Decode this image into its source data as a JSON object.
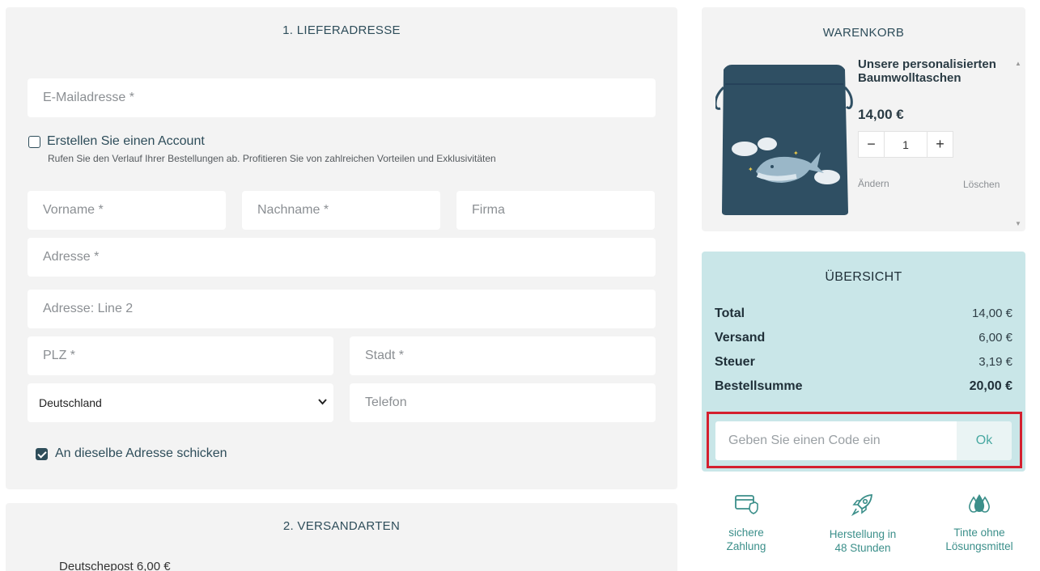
{
  "delivery": {
    "title": "1. LIEFERADRESSE",
    "email_placeholder": "E-Mailadresse *",
    "create_account_label": "Erstellen Sie einen Account",
    "create_account_hint": "Rufen Sie den Verlauf Ihrer Bestellungen ab. Profitieren Sie von zahlreichen Vorteilen und Exklusivitäten",
    "firstname_placeholder": "Vorname *",
    "lastname_placeholder": "Nachname *",
    "company_placeholder": "Firma",
    "address_placeholder": "Adresse *",
    "address2_placeholder": "Adresse: Line 2",
    "zip_placeholder": "PLZ *",
    "city_placeholder": "Stadt *",
    "country_value": "Deutschland",
    "phone_placeholder": "Telefon",
    "same_address_label": "An dieselbe Adresse schicken",
    "same_address_checked": true
  },
  "shipping": {
    "title": "2. VERSANDARTEN",
    "option_label": "Deutschepost 6,00 €"
  },
  "cart": {
    "title": "WARENKORB",
    "product_name": "Unsere personalisierten Baumwolltaschen",
    "product_price": "14,00 €",
    "quantity": "1",
    "minus": "−",
    "plus": "+",
    "edit_label": "Ändern",
    "delete_label": "Löschen",
    "scroll_up": "▲",
    "scroll_down": "▼"
  },
  "summary": {
    "title": "ÜBERSICHT",
    "rows": [
      {
        "label": "Total",
        "value": "14,00 €"
      },
      {
        "label": "Versand",
        "value": "6,00 €"
      },
      {
        "label": "Steuer",
        "value": "3,19 €"
      },
      {
        "label": "Bestellsumme",
        "value": "20,00 €"
      }
    ],
    "code_placeholder": "Geben Sie einen Code ein",
    "code_button": "Ok"
  },
  "features": [
    {
      "icon": "secure-card-icon",
      "line1": "sichere",
      "line2": "Zahlung"
    },
    {
      "icon": "rocket-icon",
      "line1": "Herstellung in",
      "line2": "48 Stunden"
    },
    {
      "icon": "ink-drops-icon",
      "line1": "Tinte ohne",
      "line2": "Lösungsmittel"
    }
  ],
  "colors": {
    "accent": "#2e4d5a",
    "summary_bg": "#c9e6e8",
    "highlight": "#d4202f",
    "feature_text": "#3b8f8a"
  }
}
